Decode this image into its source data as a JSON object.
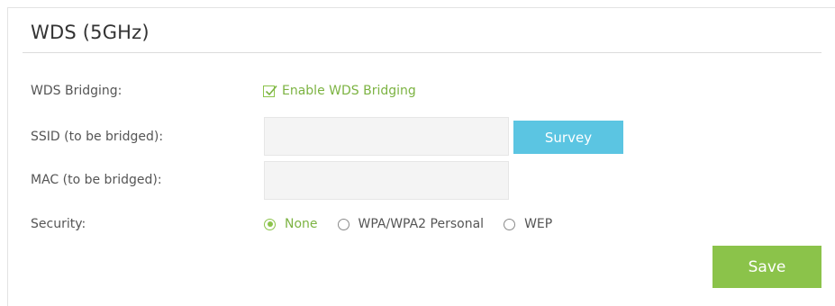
{
  "panel": {
    "title": "WDS (5GHz)"
  },
  "fields": {
    "wds_bridging": {
      "label": "WDS Bridging:",
      "checkbox_label": "Enable WDS Bridging",
      "checked": true
    },
    "ssid": {
      "label": "SSID (to be bridged):",
      "value": "",
      "placeholder": ""
    },
    "mac": {
      "label": "MAC (to be bridged):",
      "value": "",
      "placeholder": ""
    },
    "security": {
      "label": "Security:",
      "options": [
        {
          "label": "None",
          "selected": true
        },
        {
          "label": "WPA/WPA2 Personal",
          "selected": false
        },
        {
          "label": "WEP",
          "selected": false
        }
      ]
    }
  },
  "buttons": {
    "survey_label": "Survey",
    "save_label": "Save"
  },
  "colors": {
    "accent_green": "#8bc34a",
    "survey_blue": "#5bc5e2",
    "input_bg": "#f4f4f4"
  }
}
